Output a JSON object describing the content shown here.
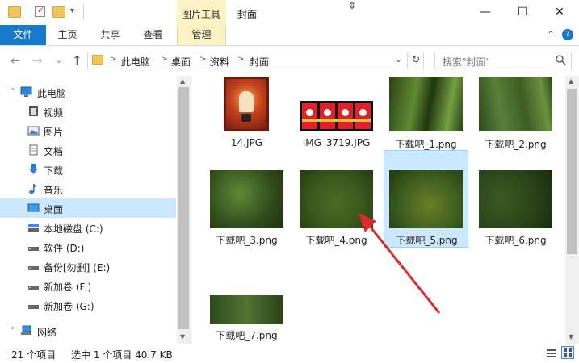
{
  "window": {
    "title": "封面",
    "context_group": "图片工具",
    "minimize": "—",
    "maximize": "☐",
    "close": "✕"
  },
  "ribbon": {
    "tabs": [
      {
        "label": "文件"
      },
      {
        "label": "主页"
      },
      {
        "label": "共享"
      },
      {
        "label": "查看"
      },
      {
        "label": "管理"
      }
    ],
    "collapse_glyph": "⌃",
    "help_glyph": "?"
  },
  "nav": {
    "back": "←",
    "forward": "→",
    "recent": "⌄",
    "up": "↑",
    "breadcrumb": [
      "此电脑",
      "桌面",
      "资料",
      "封面"
    ],
    "crumb_sep": ">",
    "dropdown": "⌄",
    "refresh": "↻",
    "search_placeholder": "搜索\"封面\"",
    "search_icon": "search-icon"
  },
  "sidebar": {
    "items": [
      {
        "label": "此电脑",
        "icon": "computer-icon"
      },
      {
        "label": "视频",
        "icon": "video-icon"
      },
      {
        "label": "图片",
        "icon": "pictures-icon"
      },
      {
        "label": "文档",
        "icon": "document-icon"
      },
      {
        "label": "下载",
        "icon": "download-icon"
      },
      {
        "label": "音乐",
        "icon": "music-icon"
      },
      {
        "label": "桌面",
        "icon": "desktop-icon",
        "selected": true
      },
      {
        "label": "本地磁盘 (C:)",
        "icon": "drive-icon"
      },
      {
        "label": "软件 (D:)",
        "icon": "drive-icon"
      },
      {
        "label": "备份[勿删] (E:)",
        "icon": "drive-icon"
      },
      {
        "label": "新加卷 (F:)",
        "icon": "drive-icon"
      },
      {
        "label": "新加卷 (G:)",
        "icon": "drive-icon"
      },
      {
        "label": "网络",
        "icon": "network-icon"
      }
    ]
  },
  "files": [
    {
      "name": "14.JPG",
      "thumb": "poster"
    },
    {
      "name": "IMG_3719.JPG",
      "thumb": "cards"
    },
    {
      "name": "下载吧_1.png",
      "thumb": "grass"
    },
    {
      "name": "下载吧_2.png",
      "thumb": "grass"
    },
    {
      "name": "下载吧_3.png",
      "thumb": "blur"
    },
    {
      "name": "下载吧_4.png",
      "thumb": "blur"
    },
    {
      "name": "下载吧_5.png",
      "thumb": "blur",
      "selected": true
    },
    {
      "name": "下载吧_6.png",
      "thumb": "blur"
    },
    {
      "name": "下载吧_7.png",
      "thumb": "blur"
    }
  ],
  "status": {
    "count": "21 个项目",
    "selection": "选中 1 个项目  40.7 KB"
  },
  "colors": {
    "accent": "#1979ca",
    "selection": "#cce8ff",
    "context_tab": "#fbf3c4",
    "arrow": "#d92b2b"
  }
}
